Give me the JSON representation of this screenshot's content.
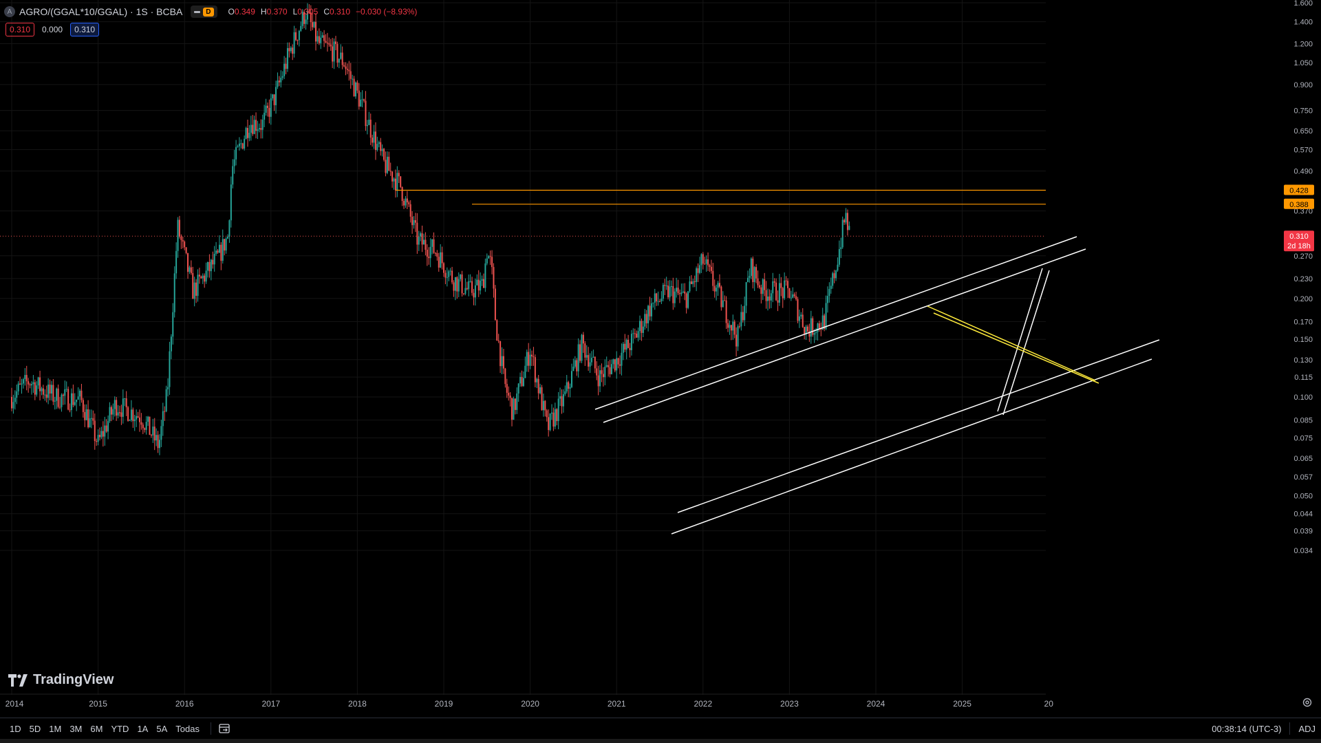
{
  "header": {
    "symbol_icon": "A",
    "title": "AGRO/(GGAL*10/GGAL) · 1S · BCBA",
    "interval_badge": "D",
    "ohlc": [
      {
        "k": "O",
        "v": "0.349"
      },
      {
        "k": "H",
        "v": "0.370"
      },
      {
        "k": "L",
        "v": "0.305"
      },
      {
        "k": "C",
        "v": "0.310"
      }
    ],
    "change": "−0.030 (−8.93%)"
  },
  "order": {
    "sell": "0.310",
    "spread": "0.000",
    "buy": "0.310"
  },
  "logo_text": "TradingView",
  "price_axis": {
    "ticks": [
      "1.600",
      "1.400",
      "1.200",
      "1.050",
      "0.900",
      "0.750",
      "0.650",
      "0.570",
      "0.490",
      "0.370",
      "0.270",
      "0.230",
      "0.200",
      "0.170",
      "0.150",
      "0.130",
      "0.115",
      "0.100",
      "0.085",
      "0.075",
      "0.065",
      "0.057",
      "0.050",
      "0.044",
      "0.039",
      "0.034"
    ],
    "labels": [
      {
        "text": "0.428",
        "color": "#ff9800"
      },
      {
        "text": "0.388",
        "color": "#ff9800"
      },
      {
        "text": "0.310",
        "sub": "2d 18h",
        "color": "#f23645"
      }
    ]
  },
  "time_axis": [
    "2014",
    "2015",
    "2016",
    "2017",
    "2018",
    "2019",
    "2020",
    "2021",
    "2022",
    "2023",
    "2024",
    "2025",
    "20"
  ],
  "bottom": {
    "ranges": [
      "1D",
      "5D",
      "1M",
      "3M",
      "6M",
      "YTD",
      "1A",
      "5A",
      "Todas"
    ],
    "clock": "00:38:14 (UTC-3)",
    "adj": "ADJ"
  },
  "colors": {
    "up": "#26a69a",
    "down": "#ef5350",
    "level": "#ff9800",
    "channel": "#ffffff",
    "yellow": "#ffeb3b"
  },
  "chart_data": {
    "type": "candlestick",
    "scale": "log",
    "ylim": [
      0.031,
      1.6
    ],
    "x_start": 2014.0,
    "x_end": 2026.0,
    "weekly_close_anchors": [
      [
        2014.0,
        0.1
      ],
      [
        2014.2,
        0.112
      ],
      [
        2014.5,
        0.1
      ],
      [
        2014.8,
        0.098
      ],
      [
        2015.0,
        0.072
      ],
      [
        2015.2,
        0.095
      ],
      [
        2015.5,
        0.087
      ],
      [
        2015.7,
        0.071
      ],
      [
        2015.8,
        0.102
      ],
      [
        2015.92,
        0.33
      ],
      [
        2016.1,
        0.21
      ],
      [
        2016.4,
        0.27
      ],
      [
        2016.5,
        0.31
      ],
      [
        2016.55,
        0.5
      ],
      [
        2016.75,
        0.69
      ],
      [
        2016.9,
        0.68
      ],
      [
        2017.05,
        0.83
      ],
      [
        2017.2,
        1.1
      ],
      [
        2017.4,
        1.5
      ],
      [
        2017.55,
        1.2
      ],
      [
        2017.7,
        1.15
      ],
      [
        2017.85,
        1.05
      ],
      [
        2018.05,
        0.78
      ],
      [
        2018.3,
        0.52
      ],
      [
        2018.5,
        0.44
      ],
      [
        2018.7,
        0.3
      ],
      [
        2018.9,
        0.28
      ],
      [
        2019.1,
        0.23
      ],
      [
        2019.3,
        0.21
      ],
      [
        2019.45,
        0.22
      ],
      [
        2019.5,
        0.28
      ],
      [
        2019.55,
        0.25
      ],
      [
        2019.6,
        0.17
      ],
      [
        2019.7,
        0.11
      ],
      [
        2019.8,
        0.09
      ],
      [
        2020.0,
        0.14
      ],
      [
        2020.2,
        0.08
      ],
      [
        2020.4,
        0.1
      ],
      [
        2020.6,
        0.145
      ],
      [
        2020.8,
        0.115
      ],
      [
        2021.0,
        0.13
      ],
      [
        2021.2,
        0.15
      ],
      [
        2021.4,
        0.19
      ],
      [
        2021.6,
        0.21
      ],
      [
        2021.8,
        0.2
      ],
      [
        2022.0,
        0.26
      ],
      [
        2022.2,
        0.2
      ],
      [
        2022.4,
        0.15
      ],
      [
        2022.55,
        0.25
      ],
      [
        2022.7,
        0.21
      ],
      [
        2022.9,
        0.21
      ],
      [
        2023.0,
        0.21
      ],
      [
        2023.2,
        0.16
      ],
      [
        2023.4,
        0.17
      ],
      [
        2023.55,
        0.26
      ],
      [
        2023.65,
        0.36
      ],
      [
        2023.7,
        0.31
      ]
    ],
    "last_close": 0.31,
    "horizontal_levels": [
      0.428,
      0.388
    ],
    "series": []
  }
}
